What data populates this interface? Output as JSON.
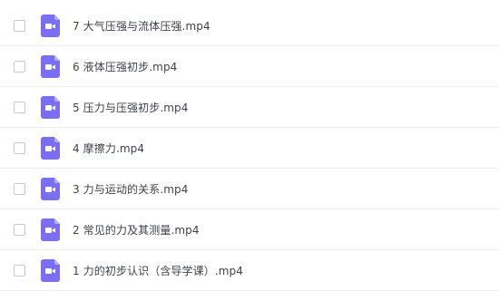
{
  "file_list": {
    "colors": {
      "icon_color": "#7a6ef2",
      "icon_fold_color": "#b3abf7",
      "text_color": "#3f4148",
      "divider_color": "#eeeff2"
    },
    "items": [
      {
        "name": "7 大气压强与流体压强.mp4",
        "icon": "video-file-icon"
      },
      {
        "name": "6 液体压强初步.mp4",
        "icon": "video-file-icon"
      },
      {
        "name": "5 压力与压强初步.mp4",
        "icon": "video-file-icon"
      },
      {
        "name": "4 摩擦力.mp4",
        "icon": "video-file-icon"
      },
      {
        "name": "3 力与运动的关系.mp4",
        "icon": "video-file-icon"
      },
      {
        "name": "2 常见的力及其测量.mp4",
        "icon": "video-file-icon"
      },
      {
        "name": "1 力的初步认识（含导学课）.mp4",
        "icon": "video-file-icon"
      }
    ]
  }
}
